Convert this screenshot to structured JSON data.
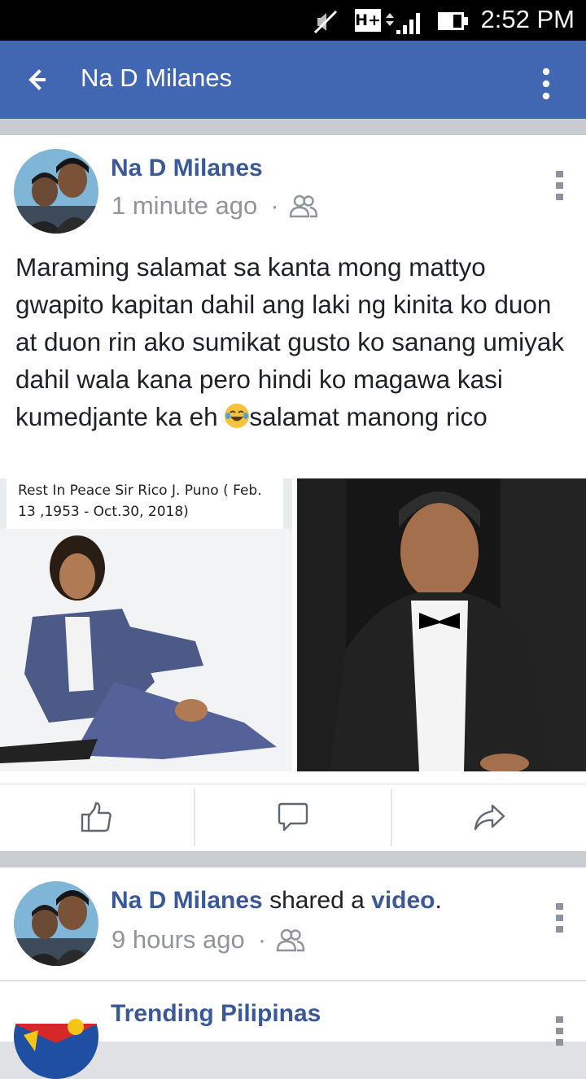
{
  "status_bar": {
    "time": "2:52 PM",
    "network": "H+",
    "icons": [
      "mute-icon",
      "signal-icon",
      "battery-icon"
    ]
  },
  "app_bar": {
    "title": "Na D Milanes",
    "icons": [
      "back-arrow-icon",
      "more-vertical-icon"
    ]
  },
  "post": {
    "author": "Na D Milanes",
    "timestamp": "1 minute ago",
    "separator": "·",
    "privacy_icon": "friends-icon",
    "text_before_emoji": "Maraming salamat sa kanta mong mattyo gwapito kapitan dahil ang laki ng kinita ko duon at duon rin ako sumikat gusto ko sanang umiyak dahil wala kana pero hindi ko magawa kasi kumedjante ka eh ",
    "emoji": "tears-of-joy-emoji",
    "text_after_emoji": "salamat manong rico",
    "image_caption": "Rest In Peace Sir Rico J.  Puno ( Feb. 13 ,1953 - Oct.30, 2018)",
    "actions": [
      "like-icon",
      "comment-icon",
      "share-icon"
    ]
  },
  "feed": [
    {
      "author": "Na D Milanes",
      "action_text": " shared a ",
      "object_link": "video",
      "trailing": ".",
      "timestamp": "9 hours ago",
      "separator": "·"
    },
    {
      "author": "Trending Pilipinas"
    }
  ],
  "colors": {
    "brand_blue": "#4267b2",
    "link_blue": "#3b5998",
    "meta_gray": "#90949c",
    "divider_gray": "#c9ccd1"
  }
}
